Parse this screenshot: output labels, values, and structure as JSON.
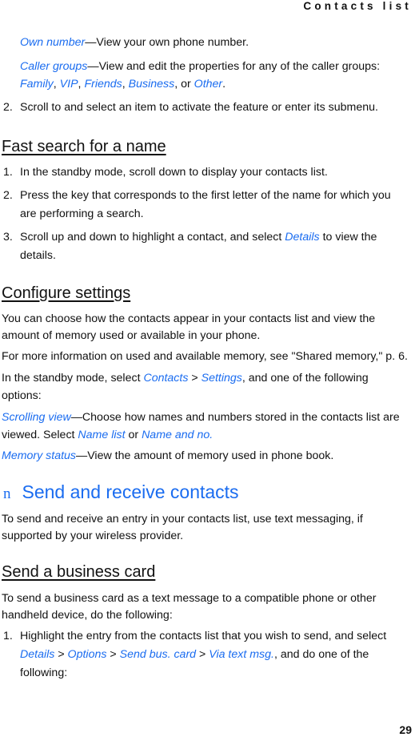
{
  "header": {
    "running_title": "Contacts list"
  },
  "intro": {
    "own_number_term": "Own number",
    "own_number_desc": "—View your own phone number.",
    "caller_groups_term": "Caller groups",
    "caller_groups_desc": "—View and edit the properties for any of the caller groups:",
    "groups": [
      "Family",
      "VIP",
      "Friends",
      "Business",
      "Other"
    ],
    "sep": ", ",
    "or": ", or ",
    "end": ".",
    "step2_num": "2.",
    "step2_text": "Scroll to and select an item to activate the feature or enter its submenu."
  },
  "fast_search": {
    "title": "Fast search for a name",
    "steps": [
      {
        "num": "1.",
        "lines": [
          "In the standby mode, scroll down to display your contacts list."
        ]
      },
      {
        "num": "2.",
        "lines": [
          "Press the key that corresponds to the first letter of the name for which you",
          "are performing a search."
        ]
      },
      {
        "num": "3.",
        "pre": "Scroll up and down to highlight a contact, and select ",
        "term": "Details",
        "post": " to view the",
        "line2": "details."
      }
    ]
  },
  "configure": {
    "title": "Configure settings",
    "p1": [
      "You can choose how the contacts appear in your contacts list and view the",
      "amount of memory used or available in your phone."
    ],
    "p2": "For more information on used and available memory, see \"Shared memory,\" p. 6.",
    "p3_pre": "In the standby mode, select ",
    "p3_term1": "Contacts",
    "p3_gt": " > ",
    "p3_term2": "Settings",
    "p3_post": ", and one of the following",
    "p3_line2": "options:",
    "scrolling_term": "Scrolling view",
    "scrolling_desc": "—Choose how names and numbers stored in the contacts list are",
    "scrolling_line2_pre": "viewed. Select ",
    "name_list": "Name list",
    "or": " or ",
    "name_and_no": "Name and no.",
    "memory_term": "Memory status",
    "memory_desc": "—View the amount of memory used in phone book."
  },
  "send_receive": {
    "bullet": "n",
    "title": "Send and receive contacts",
    "p1": [
      "To send and receive an entry in your contacts list, use text messaging, if",
      "supported by your wireless provider."
    ]
  },
  "business_card": {
    "title": "Send a business card",
    "p1": [
      "To send a business card as a text message to a compatible phone or other",
      "handheld device, do the following:"
    ],
    "step1_num": "1.",
    "step1_line1": "Highlight the entry from the contacts list that you wish to send, and select",
    "path": [
      "Details",
      "Options",
      "Send bus. card",
      "Via text msg."
    ],
    "gt": " > ",
    "step1_post": ", and do one of the",
    "step1_line3": "following:"
  },
  "footer": {
    "page_number": "29"
  }
}
